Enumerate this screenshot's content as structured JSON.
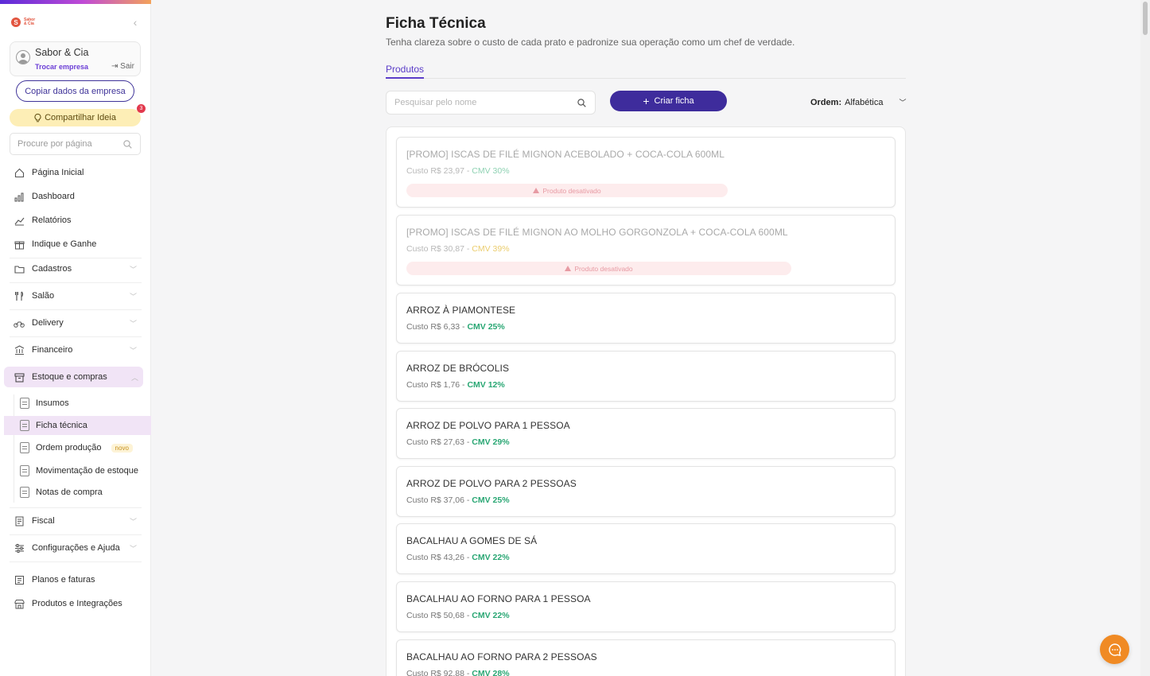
{
  "sidebar": {
    "logo_letter": "S",
    "logo_text_1": "Sabor",
    "logo_text_2": "& Cia",
    "collapse_glyph": "‹",
    "company_name": "Sabor & Cia",
    "switch_label": "Trocar empresa",
    "exit_label": "⇥ Sair",
    "copy_button": "Copiar dados da empresa",
    "idea_button": "Compartilhar Ideia",
    "idea_badge": "3",
    "search_placeholder": "Procure por página",
    "nav": [
      {
        "label": "Página Inicial"
      },
      {
        "label": "Dashboard"
      },
      {
        "label": "Relatórios"
      },
      {
        "label": "Indique e Ganhe"
      },
      {
        "label": "Cadastros"
      },
      {
        "label": "Salão"
      },
      {
        "label": "Delivery"
      },
      {
        "label": "Financeiro"
      },
      {
        "label": "Estoque e compras"
      },
      {
        "label": "Fiscal"
      },
      {
        "label": "Configurações e Ajuda"
      },
      {
        "label": "Planos e faturas"
      },
      {
        "label": "Produtos e Integrações"
      }
    ],
    "sub_items": [
      {
        "label": "Insumos"
      },
      {
        "label": "Ficha técnica"
      },
      {
        "label": "Ordem produção",
        "badge": "novo"
      },
      {
        "label": "Movimentação de estoque"
      },
      {
        "label": "Notas de compra"
      }
    ]
  },
  "main": {
    "title": "Ficha Técnica",
    "subtitle": "Tenha clareza sobre o custo de cada prato e padronize sua operação como um chef de verdade.",
    "tab_label": "Produtos",
    "search_placeholder": "Pesquisar pelo nome",
    "create_button": "Criar ficha",
    "order_label": "Ordem:",
    "order_value": "Alfabética",
    "products": [
      {
        "name": "[PROMO] ISCAS DE FILÉ MIGNON ACEBOLADO + COCA-COLA 600ML",
        "cost": "Custo R$ 23,97 - ",
        "cmv": "CMV 30%",
        "status": "Produto desativado"
      },
      {
        "name": "[PROMO] ISCAS DE FILÉ MIGNON AO MOLHO GORGONZOLA + COCA-COLA 600ML",
        "cost": "Custo R$ 30,87 - ",
        "cmv": "CMV 39%",
        "status": "Produto desativado"
      },
      {
        "name": "ARROZ À PIAMONTESE",
        "cost": "Custo R$ 6,33 - ",
        "cmv": "CMV 25%"
      },
      {
        "name": "ARROZ DE BRÓCOLIS",
        "cost": "Custo R$ 1,76 - ",
        "cmv": "CMV 12%"
      },
      {
        "name": "ARROZ DE POLVO PARA 1 PESSOA",
        "cost": "Custo R$ 27,63 - ",
        "cmv": "CMV 29%"
      },
      {
        "name": "ARROZ DE POLVO PARA 2 PESSOAS",
        "cost": "Custo R$ 37,06 - ",
        "cmv": "CMV 25%"
      },
      {
        "name": "BACALHAU A GOMES DE SÁ",
        "cost": "Custo R$ 43,26 - ",
        "cmv": "CMV 22%"
      },
      {
        "name": "BACALHAU AO FORNO PARA 1 PESSOA",
        "cost": "Custo R$ 50,68 - ",
        "cmv": "CMV 22%"
      },
      {
        "name": "BACALHAU AO FORNO PARA 2 PESSOAS",
        "cost": "Custo R$ 92,88 - ",
        "cmv": "CMV 28%"
      }
    ]
  },
  "colors": {
    "accent": "#3e2c9c",
    "cmv_green": "#2aa774",
    "chat_orange": "#f08a24",
    "active_nav_bg": "#f1e4f6"
  }
}
